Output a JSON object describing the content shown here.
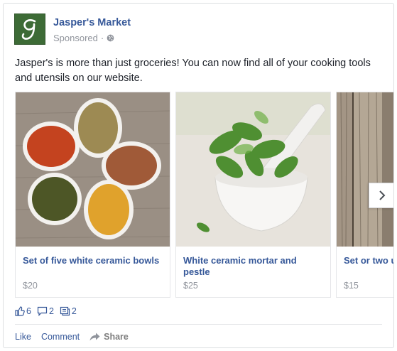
{
  "post": {
    "page_name": "Jasper's Market",
    "sponsored_label": "Sponsored",
    "separator": "·",
    "text": "Jasper's is more than just groceries! You can now find all of your cooking tools and utensils on our website.",
    "avatar_letter": "g",
    "avatar_color": "#3d6b36"
  },
  "carousel": {
    "cards": [
      {
        "title": "Set of five white ceramic bowls",
        "price": "$20",
        "image": "spices-in-bowls"
      },
      {
        "title": "White ceramic mortar and pestle",
        "price": "$25",
        "image": "mortar-pestle-with-mint"
      },
      {
        "title": "Set or two utensils",
        "price": "$15",
        "image": "wood-planks"
      }
    ]
  },
  "stats": {
    "likes": "6",
    "comments": "2",
    "shares": "2"
  },
  "actions": {
    "like": "Like",
    "comment": "Comment",
    "share": "Share"
  },
  "colors": {
    "link": "#365899",
    "muted": "#90949c",
    "border": "#dddfe2"
  }
}
